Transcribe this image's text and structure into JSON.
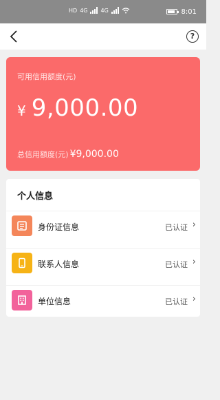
{
  "status_bar": {
    "carrier_tags": [
      "HD",
      "HD"
    ],
    "network_labels": [
      "4G",
      "4G"
    ],
    "time": "8:01"
  },
  "nav": {
    "back_icon": "chevron-left-icon",
    "help_icon": "question-circle-icon",
    "help_glyph": "?"
  },
  "credit": {
    "available_label": "可用信用额度(元)",
    "currency": "¥",
    "available_amount": "9,000.00",
    "total_label": "总信用额度(元)",
    "total_amount": "¥9,000.00",
    "card_color": "#fb6a6a"
  },
  "personal_info": {
    "title": "个人信息",
    "items": [
      {
        "label": "身份证信息",
        "status": "已认证",
        "icon": "id-card-icon",
        "color": "#f4865a"
      },
      {
        "label": "联系人信息",
        "status": "已认证",
        "icon": "phone-icon",
        "color": "#f6b316"
      },
      {
        "label": "单位信息",
        "status": "已认证",
        "icon": "building-icon",
        "color": "#f2629b"
      }
    ]
  }
}
